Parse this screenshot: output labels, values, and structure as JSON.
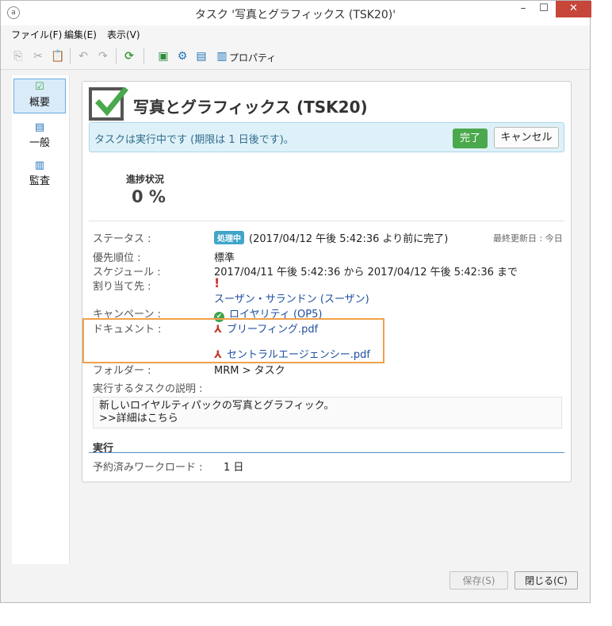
{
  "window": {
    "title": "タスク '写真とグラフィックス (TSK20)'",
    "controls": {
      "minimize": "–",
      "maximize": "☐",
      "close": "✕"
    }
  },
  "menu": [
    "ファイル(F)",
    "編集(E)",
    "表示(V)"
  ],
  "toolbar": {
    "properties_label": "プロパティ"
  },
  "sidebar": {
    "items": [
      {
        "label": "概要",
        "icon": "check-icon"
      },
      {
        "label": "一般",
        "icon": "clipboard-icon"
      },
      {
        "label": "監査",
        "icon": "audit-icon"
      }
    ]
  },
  "header": {
    "title": "写真とグラフィックス (TSK20)"
  },
  "alert": {
    "text": "タスクは実行中です (期限は 1 日後です)。",
    "done_label": "完了",
    "cancel_label": "キャンセル"
  },
  "progress": {
    "label": "進捗状況",
    "value": "0 %"
  },
  "details": {
    "last_modified": "最終更新日 : 今日",
    "status_label": "ステータス :",
    "status_badge": "処理中",
    "status_text": "(2017/04/12 午後 5:42:36 より前に完了)",
    "priority_label": "優先順位 :",
    "priority_value": "標準",
    "schedule_label": "スケジュール :",
    "schedule_value": "2017/04/11 午後 5:42:36 から 2017/04/12 午後 5:42:36 まで",
    "assignee_label": "割り当て先 :",
    "assignee_value": "スーザン・サランドン (スーザン)",
    "campaign_label": "キャンペーン :",
    "campaign_value": "ロイヤリティ (OP5)",
    "documents_label": "ドキュメント :",
    "documents": [
      "ブリーフィング.pdf",
      "セントラルエージェンシー.pdf"
    ],
    "folder_label": "フォルダー :",
    "folder_value": "MRM > タスク",
    "description_label": "実行するタスクの説明 :",
    "description_line1": "新しいロイヤルティパックの写真とグラフィック。",
    "description_line2": ">>詳細はこちら"
  },
  "execution": {
    "title": "実行",
    "workload_label": "予約済みワークロード :",
    "workload_value": "1 日"
  },
  "footer": {
    "save_label": "保存(S)",
    "close_label": "閉じる(C)"
  },
  "colors": {
    "accent_green": "#4aa84d",
    "alert_bg": "#dff1f8",
    "link": "#1e4fa0",
    "highlight": "#f0a14a",
    "priority_red": "#d0312d"
  }
}
